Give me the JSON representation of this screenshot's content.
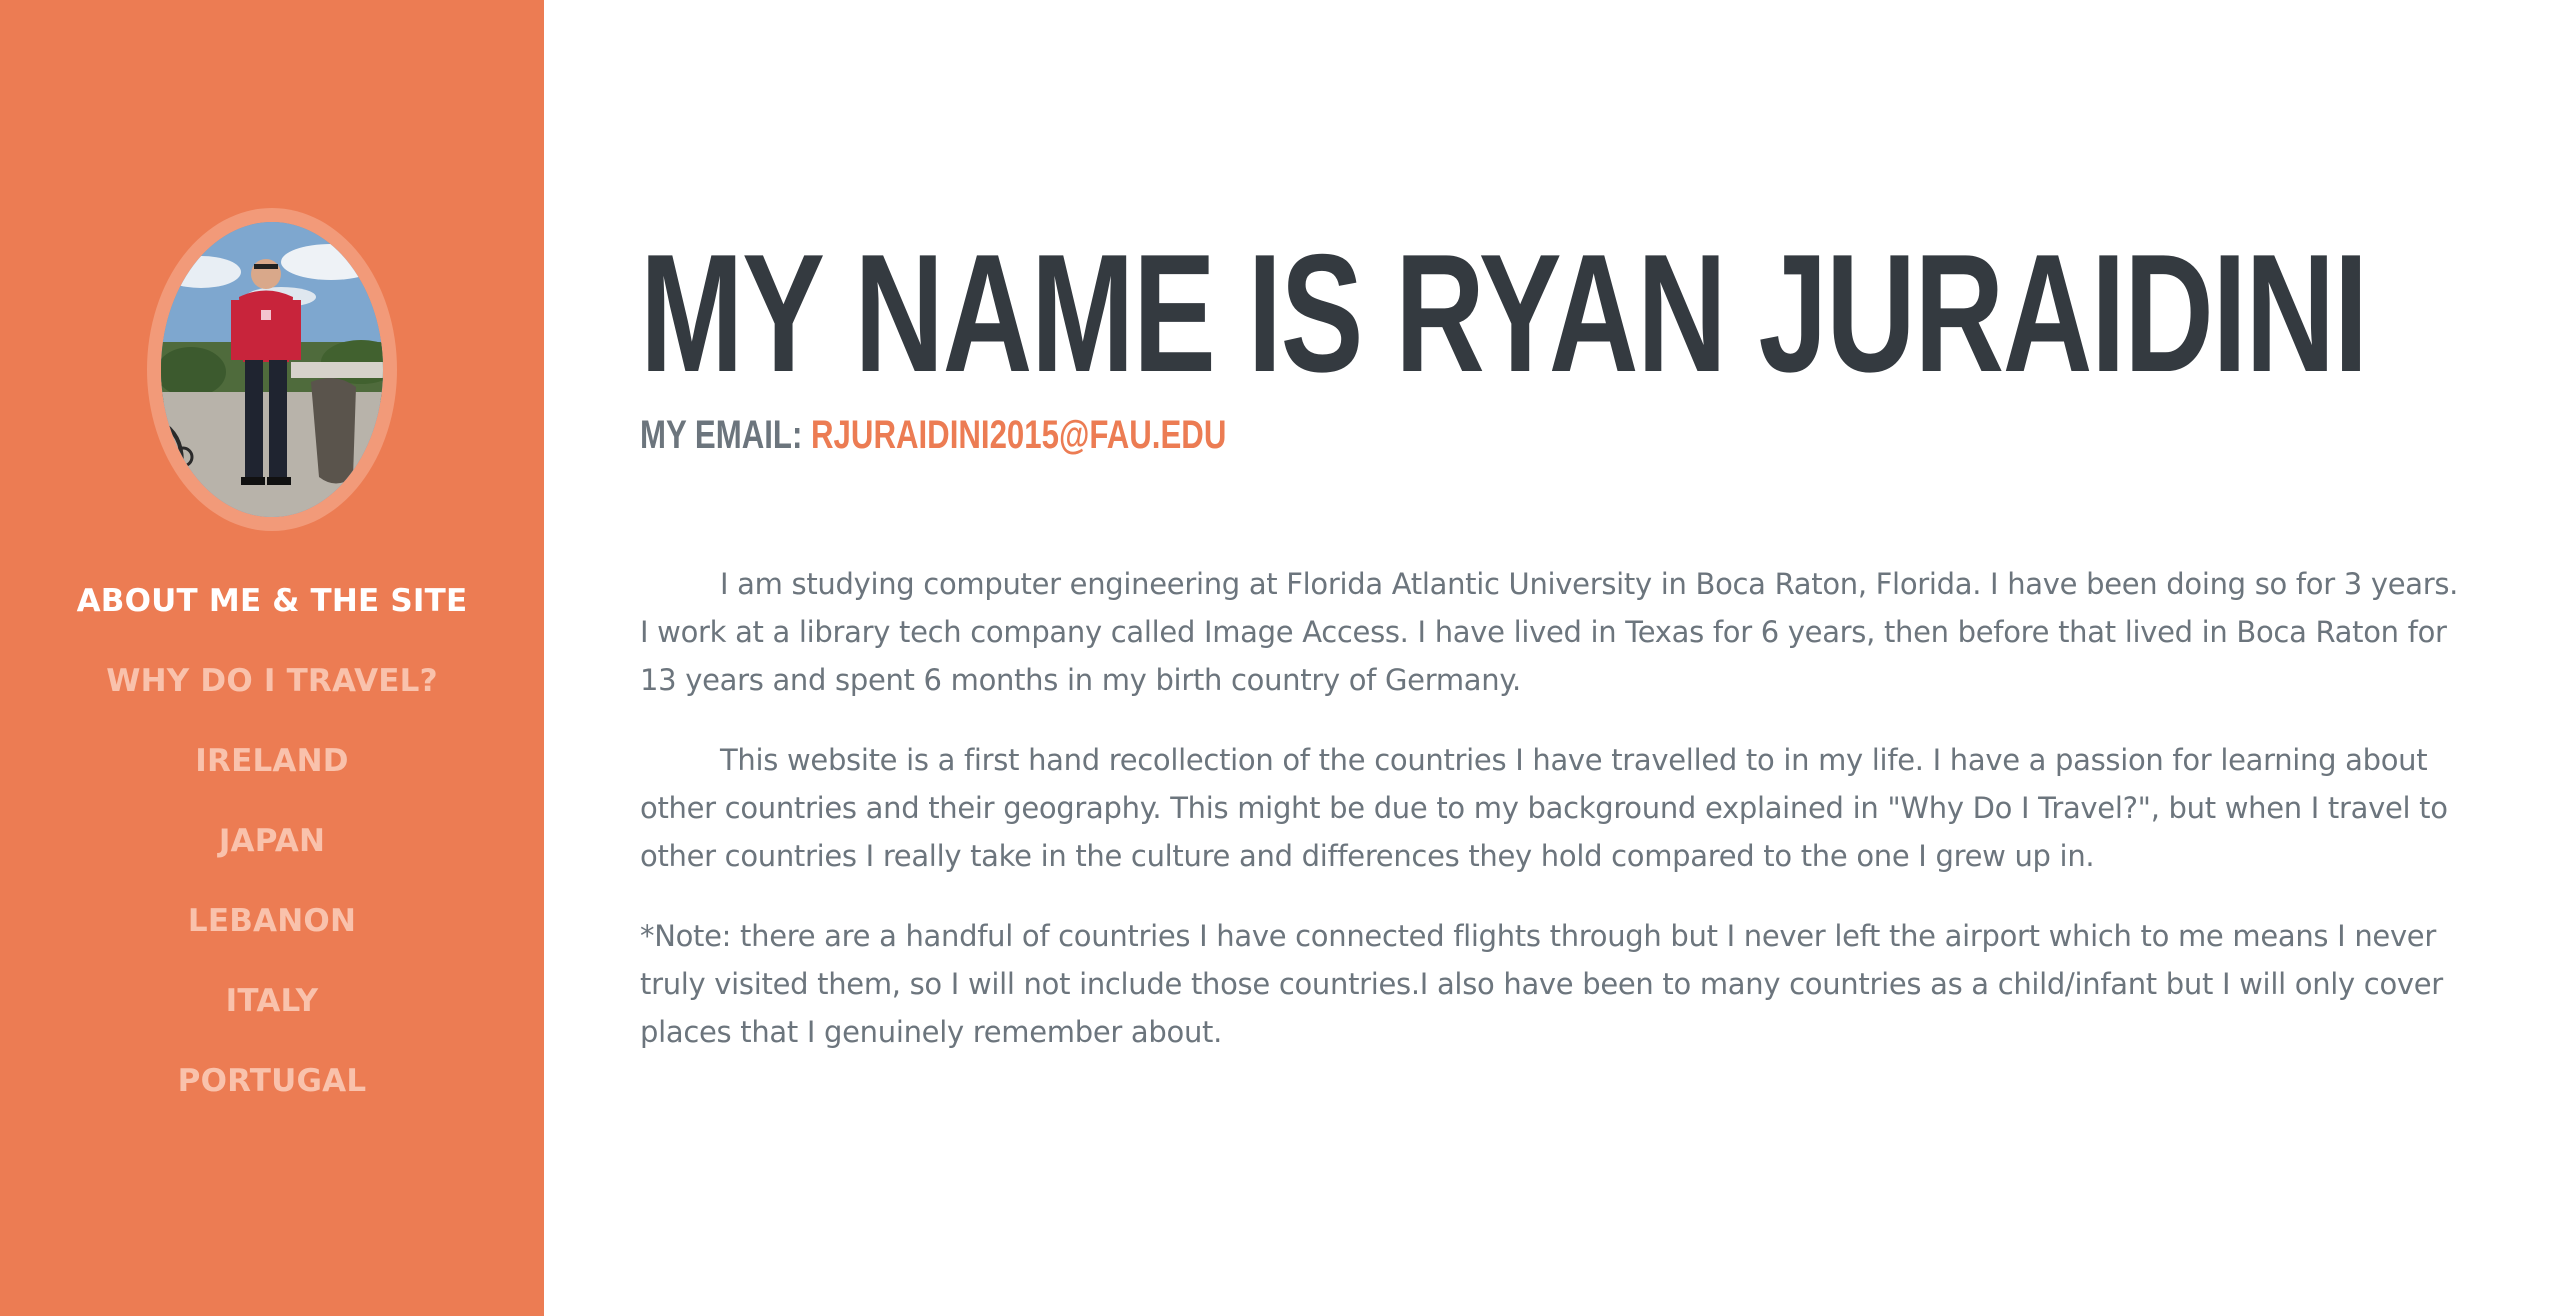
{
  "sidebar": {
    "avatar_alt": "Profile photo",
    "nav": [
      {
        "label": "ABOUT ME & THE SITE",
        "active": true
      },
      {
        "label": "WHY DO I TRAVEL?",
        "active": false
      },
      {
        "label": "IRELAND",
        "active": false
      },
      {
        "label": "JAPAN",
        "active": false
      },
      {
        "label": "LEBANON",
        "active": false
      },
      {
        "label": "ITALY",
        "active": false
      },
      {
        "label": "PORTUGAL",
        "active": false
      }
    ]
  },
  "main": {
    "title": "MY NAME IS RYAN JURAIDINI",
    "email_label": "MY EMAIL: ",
    "email_value": "RJURAIDINI2015@FAU.EDU",
    "paragraphs": [
      "I am studying computer engineering at Florida Atlantic University in Boca Raton, Florida. I have been doing so for 3 years. I work at a library tech company called Image Access. I have lived in Texas for 6 years, then before that lived in Boca Raton for 13 years and spent 6 months in my birth country of Germany.",
      "This website is a first hand recollection of the countries I have travelled to in my life. I have a passion for learning about other countries and their geography. This might be due to my background explained in \"Why Do I Travel?\", but when I travel to other countries I really take in the culture and differences they hold compared to the one I grew up in.",
      "*Note: there are a handful of countries I have connected flights through but I never left the airport which to me means I never truly visited them, so I will not include those countries.I also have been to many countries as a child/infant but I will only cover places that I genuinely remember about."
    ]
  },
  "colors": {
    "sidebar_bg": "#ec7c53",
    "accent": "#ec7c53",
    "heading": "#343a40",
    "body_text": "#6c757d"
  }
}
